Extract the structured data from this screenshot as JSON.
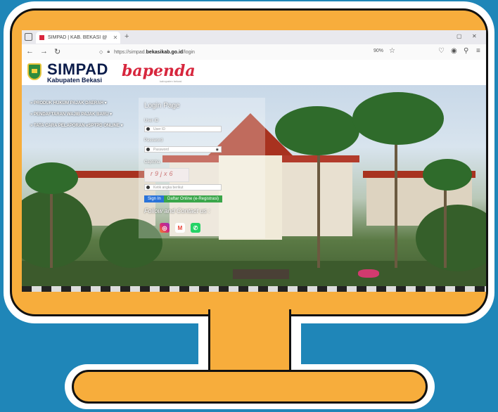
{
  "browser": {
    "tab_title": "SIMPAD | KAB. BEKASI @",
    "new_tab": "+",
    "url_prefix": "https://simpad.",
    "url_domain": "bekasikab.go.id",
    "url_suffix": "/login",
    "zoom": "90%"
  },
  "header": {
    "logo_title": "SIMPAD",
    "logo_subtitle": "Kabupaten Bekasi",
    "partner_logo": "bapenda",
    "partner_tagline": "kabupaten bekasi"
  },
  "menu": {
    "items": [
      "» PRODUK HUKUM PAJAK DAERAH ▾",
      "» PENDAFTARAN WAJIB PAJAK BARU ▾",
      "» TATA CARA PELAPORAN eSPTPD ONLINE ▾"
    ]
  },
  "login": {
    "title": "Login Page",
    "userid_label": "User ID",
    "userid_placeholder": "User ID",
    "password_label": "Password",
    "password_placeholder": "Password",
    "captcha_label": "Captcha",
    "captcha_text": "r9jx6",
    "captcha_placeholder": "Ketik angka berikut",
    "signin_label": "Sign In",
    "register_label": "Daftar Online (e-Registrasi)",
    "follow_label": "Follow and Contact us :"
  },
  "social": {
    "icons": [
      "instagram-icon",
      "gmail-icon",
      "whatsapp-icon"
    ],
    "colors": {
      "instagram": "#d62976",
      "gmail": "#ea4335",
      "whatsapp": "#25d366"
    }
  },
  "colors": {
    "background": "#1f86b8",
    "monitor_frame": "#f7ad3c",
    "signin": "#2a73d9",
    "register": "#3aa64a"
  }
}
